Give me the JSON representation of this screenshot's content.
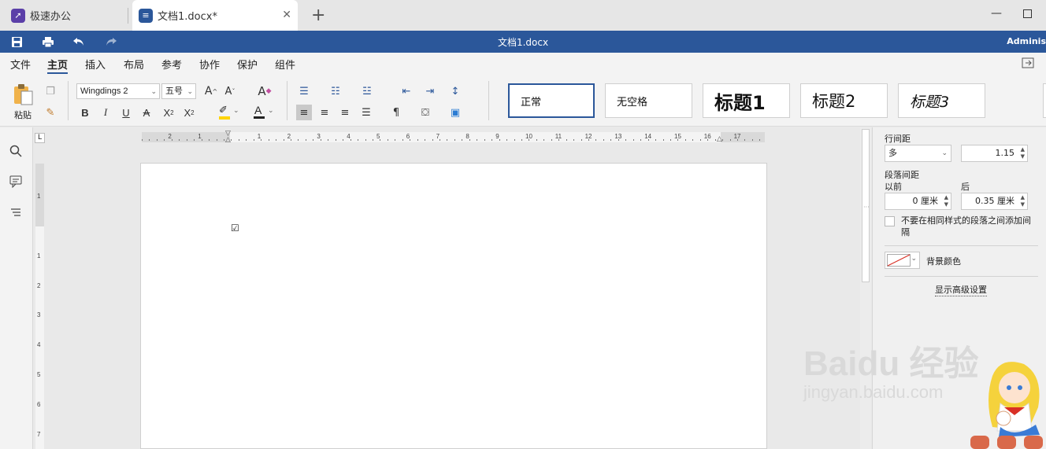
{
  "tabs": {
    "home_label": "极速办公",
    "doc_label": "文档1.docx*",
    "close_glyph": "✕",
    "add_glyph": "+"
  },
  "titlebar": {
    "title": "文档1.docx",
    "user": "Adminis"
  },
  "menu": {
    "items": [
      "文件",
      "主页",
      "插入",
      "布局",
      "参考",
      "协作",
      "保护",
      "组件"
    ],
    "active": "主页"
  },
  "ribbon": {
    "paste_label": "粘贴",
    "font_name": "Wingdings 2",
    "font_size": "五号",
    "styles": [
      "正常",
      "无空格",
      "标题1",
      "标题2",
      "标题3"
    ]
  },
  "ruler": {
    "h_numbers": [
      "2",
      "1",
      "1",
      "2",
      "3",
      "4",
      "5",
      "6",
      "7",
      "8",
      "9",
      "10",
      "11",
      "12",
      "13",
      "14",
      "15",
      "16",
      "17"
    ],
    "v_numbers": [
      "1",
      "1",
      "2",
      "3",
      "4",
      "5",
      "6",
      "7"
    ]
  },
  "document": {
    "checkbox_glyph": "☑"
  },
  "panel": {
    "line_spacing_label": "行间距",
    "line_spacing_type": "多",
    "line_spacing_value": "1.15",
    "paragraph_spacing_label": "段落间距",
    "before_label": "以前",
    "after_label": "后",
    "before_value": "0 厘米",
    "after_value": "0.35 厘米",
    "no_space_checkbox_label": "不要在相同样式的段落之间添加间隔",
    "background_color_label": "背景颜色",
    "advanced_link": "显示高级设置"
  },
  "watermark": {
    "brand": "Baidu 经验",
    "url": "jingyan.baidu.com"
  },
  "colors": {
    "accent": "#2b579a",
    "home_icon": "#5b3fa8",
    "highlight": "#ffd400",
    "font_color": "#d93025"
  }
}
